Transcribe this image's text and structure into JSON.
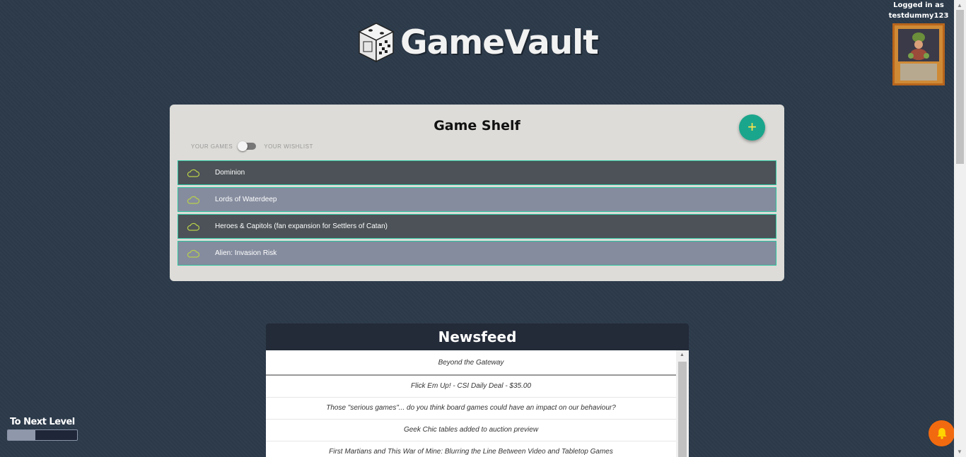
{
  "app": {
    "title": "GameVault"
  },
  "user": {
    "logged_in_label": "Logged in as",
    "username": "testdummy123"
  },
  "shelf": {
    "title": "Game Shelf",
    "add_label": "+",
    "toggle": {
      "left_label": "YOUR GAMES",
      "right_label": "YOUR WISHLIST",
      "state": "your-games"
    },
    "games": [
      {
        "name": "Dominion"
      },
      {
        "name": "Lords of Waterdeep"
      },
      {
        "name": "Heroes & Capitols (fan expansion for Settlers of Catan)"
      },
      {
        "name": "Alien: Invasion Risk"
      }
    ]
  },
  "newsfeed": {
    "title": "Newsfeed",
    "items": [
      "Beyond the Gateway",
      "Flick Em Up! - CSI Daily Deal - $35.00",
      "Those \"serious games\"... do you think board games could have an impact on our behaviour?",
      "Geek Chic tables added to auction preview",
      "First Martians and This War of Mine: Blurring the Line Between Video and Tabletop Games"
    ]
  },
  "level": {
    "label": "To Next Level",
    "progress": 0.4
  },
  "colors": {
    "accent": "#1aa68c",
    "notification": "#f26a0f",
    "background": "#2c3a4a"
  }
}
